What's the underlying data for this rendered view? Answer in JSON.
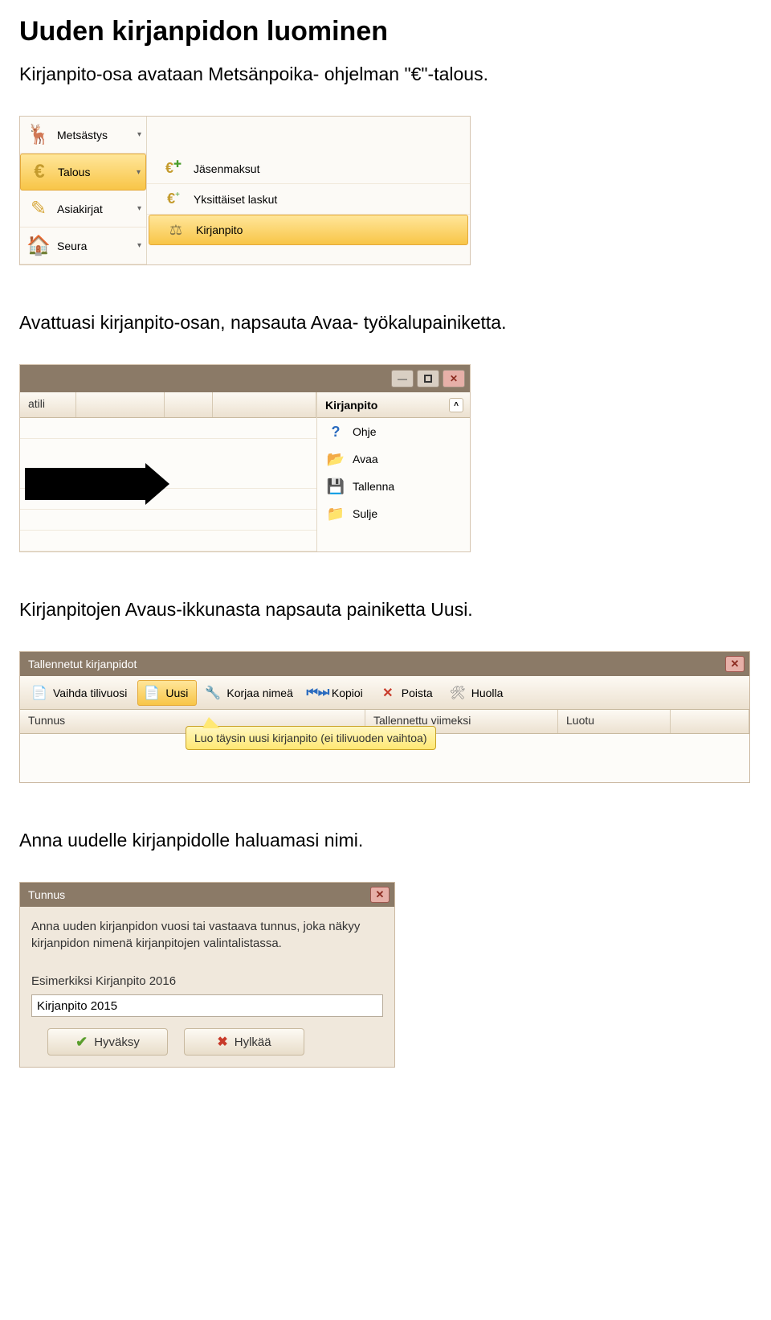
{
  "doc": {
    "heading": "Uuden kirjanpidon luominen",
    "p1": "Kirjanpito-osa avataan Metsänpoika- ohjelman \"€\"-talous.",
    "p2": "Avattuasi kirjanpito-osan, napsauta Avaa- työkalupainiketta.",
    "p3": "Kirjanpitojen Avaus-ikkunasta napsauta painiketta Uusi.",
    "p4": "Anna uudelle kirjanpidolle haluamasi nimi."
  },
  "s1": {
    "left": {
      "metsastys": "Metsästys",
      "talous": "Talous",
      "asiakirjat": "Asiakirjat",
      "seura": "Seura"
    },
    "right": {
      "jasenmaksut": "Jäsenmaksut",
      "yksittaiset": "Yksittäiset laskut",
      "kirjanpito": "Kirjanpito"
    }
  },
  "s2": {
    "header_atili": "atili",
    "panel_title": "Kirjanpito",
    "items": {
      "ohje": "Ohje",
      "avaa": "Avaa",
      "tallenna": "Tallenna",
      "sulje": "Sulje"
    }
  },
  "s3": {
    "title": "Tallennetut kirjanpidot",
    "toolbar": {
      "vaihda": "Vaihda tilivuosi",
      "uusi": "Uusi",
      "korjaa": "Korjaa nimeä",
      "kopioi": "Kopioi",
      "poista": "Poista",
      "huolla": "Huolla"
    },
    "columns": {
      "tunnus": "Tunnus",
      "tallennettu": "Tallennettu viimeksi",
      "luotu": "Luotu"
    },
    "tooltip": "Luo täysin uusi kirjanpito (ei tilivuoden vaihtoa)"
  },
  "s4": {
    "title": "Tunnus",
    "description": "Anna uuden kirjanpidon vuosi tai vastaava tunnus, joka näkyy kirjanpidon nimenä kirjanpitojen valintalistassa.",
    "example": "Esimerkiksi  Kirjanpito 2016",
    "input_value": "Kirjanpito 2015",
    "accept": "Hyväksy",
    "reject": "Hylkää"
  }
}
